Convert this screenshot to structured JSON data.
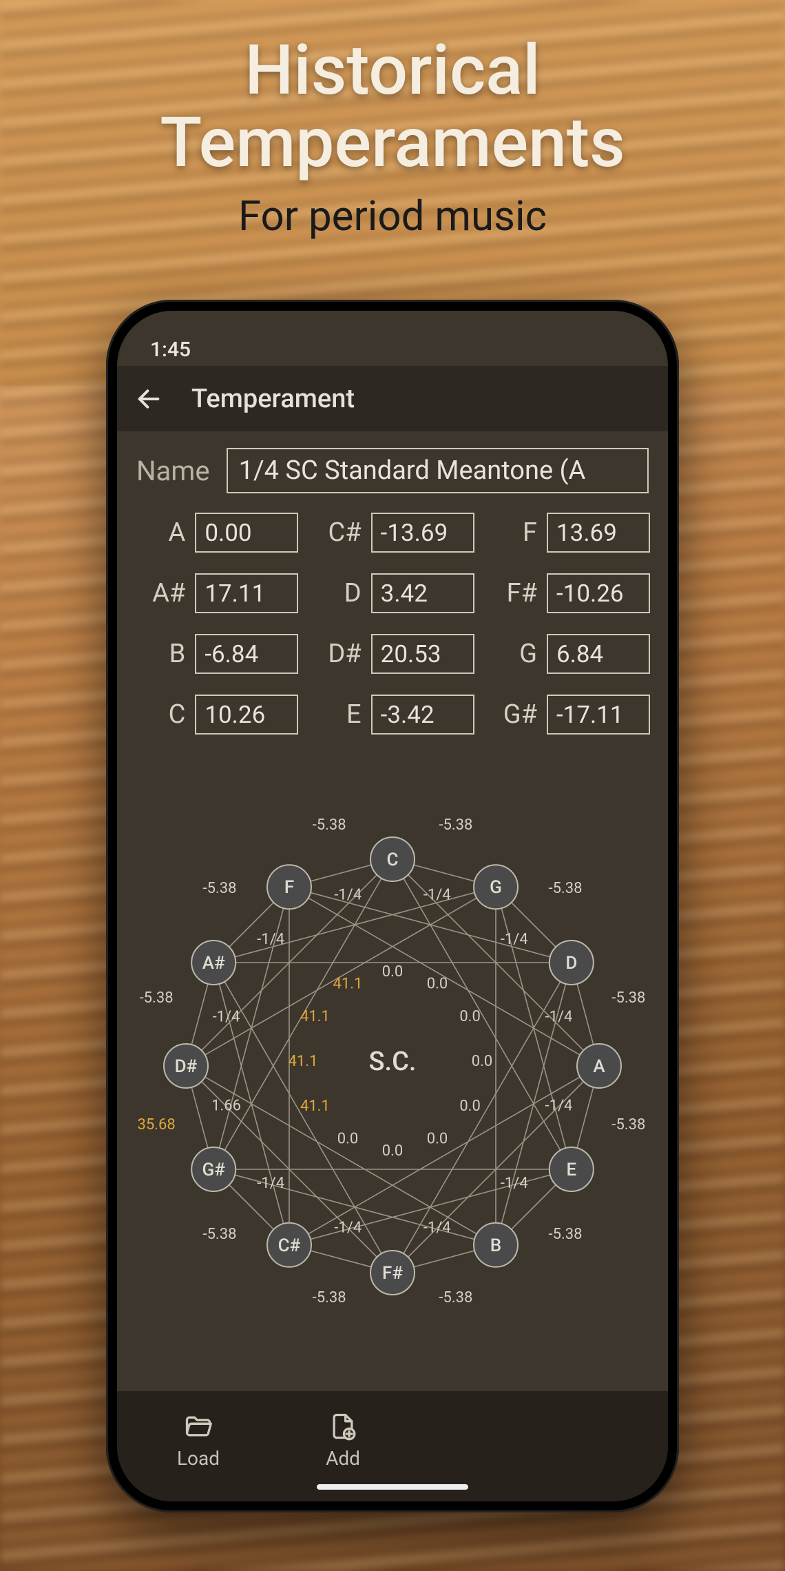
{
  "promo": {
    "title_line1": "Historical",
    "title_line2": "Temperaments",
    "subtitle": "For period music"
  },
  "status": {
    "time": "1:45"
  },
  "appbar": {
    "title": "Temperament"
  },
  "name": {
    "label": "Name",
    "value": "1/4 SC Standard Meantone (A"
  },
  "notes": [
    {
      "n": "A",
      "v": "0.00"
    },
    {
      "n": "C#",
      "v": "-13.69"
    },
    {
      "n": "F",
      "v": "13.69"
    },
    {
      "n": "A#",
      "v": "17.11"
    },
    {
      "n": "D",
      "v": "3.42"
    },
    {
      "n": "F#",
      "v": "-10.26"
    },
    {
      "n": "B",
      "v": "-6.84"
    },
    {
      "n": "D#",
      "v": "20.53"
    },
    {
      "n": "G",
      "v": "6.84"
    },
    {
      "n": "C",
      "v": "10.26"
    },
    {
      "n": "E",
      "v": "-3.42"
    },
    {
      "n": "G#",
      "v": "-17.11"
    }
  ],
  "circle": {
    "center": "S.C.",
    "order": [
      "C",
      "G",
      "D",
      "A",
      "E",
      "B",
      "F#",
      "C#",
      "G#",
      "D#",
      "A#",
      "F"
    ],
    "outer_fifths": [
      "-5.38",
      "-5.38",
      "-5.38",
      "-5.38",
      "-5.38",
      "-5.38",
      "-5.38",
      "-5.38",
      "35.68",
      "-5.38",
      "-5.38",
      "-5.38"
    ],
    "inner_fifths": [
      "-1/4",
      "-1/4",
      "-1/4",
      "-1/4",
      "-1/4",
      "-1/4",
      "-1/4",
      "-1/4",
      "1.66",
      "-1/4",
      "-1/4",
      "-1/4"
    ],
    "thirds": [
      "0.0",
      "0.0",
      "0.0",
      "0.0",
      "0.0",
      "0.0",
      "0.0",
      "0.0",
      "41.1",
      "41.1",
      "41.1",
      "41.1"
    ],
    "gold_outer_index": 8,
    "gold_thirds_start": 8
  },
  "bottom": {
    "load": "Load",
    "add": "Add"
  }
}
